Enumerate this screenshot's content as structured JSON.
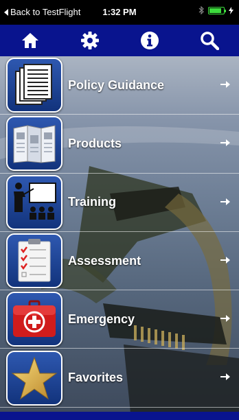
{
  "status_bar": {
    "back_label": "Back to TestFlight",
    "time": "1:32 PM",
    "battery_level": 0.85,
    "colors": {
      "battery": "#3ddc3d"
    }
  },
  "nav_bar": {
    "color": "#09148e",
    "buttons": [
      {
        "icon": "home-icon"
      },
      {
        "icon": "gear-icon"
      },
      {
        "icon": "info-icon"
      },
      {
        "icon": "search-icon"
      }
    ]
  },
  "menu": {
    "items": [
      {
        "label": "Policy Guidance",
        "icon": "documents-icon"
      },
      {
        "label": "Products",
        "icon": "brochure-icon"
      },
      {
        "label": "Training",
        "icon": "presentation-icon"
      },
      {
        "label": "Assessment",
        "icon": "checklist-icon"
      },
      {
        "label": "Emergency",
        "icon": "first-aid-kit-icon"
      },
      {
        "label": "Favorites",
        "icon": "star-icon"
      }
    ]
  }
}
